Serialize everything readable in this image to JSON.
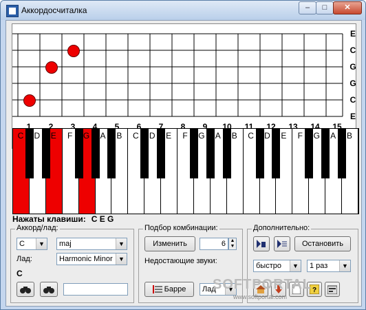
{
  "window": {
    "title": "Аккордосчиталка",
    "minimize_label": "–",
    "maximize_label": "□",
    "close_label": "✕"
  },
  "fretboard": {
    "strings": [
      "E",
      "C",
      "G",
      "G",
      "C",
      "E"
    ],
    "fret_numbers": [
      "1",
      "2",
      "3",
      "4",
      "5",
      "6",
      "7",
      "8",
      "9",
      "10",
      "11",
      "12",
      "13",
      "14",
      "15"
    ]
  },
  "keyboard": {
    "labels": [
      "C",
      "D",
      "E",
      "F",
      "G",
      "A",
      "B",
      "C",
      "D",
      "E",
      "F",
      "G",
      "A",
      "B",
      "C",
      "D",
      "E",
      "F",
      "G",
      "A",
      "B"
    ],
    "pressed_white": [
      0,
      2,
      4
    ],
    "pressed_label": "Нажаты клавиши:",
    "pressed_notes": "C E G"
  },
  "chord_group": {
    "title": "Аккорд/лад:",
    "root": "C",
    "type": "maj",
    "scale_label": "Лад:",
    "scale": "Harmonic Minor",
    "chord_name": "C",
    "search_value": ""
  },
  "combo_group": {
    "title": "Подбор комбинации:",
    "change_label": "Изменить",
    "count": "6",
    "missing_label": "Недостающие звуки:",
    "barre_label": "Барре",
    "lad_value": "Лад"
  },
  "extra_group": {
    "title": "Дополнительно:",
    "stop_label": "Остановить",
    "speed": "быстро",
    "repeat": "1 раз"
  },
  "watermark": {
    "text": "SOFTPORTAL",
    "sub": "www.softportal.com"
  }
}
